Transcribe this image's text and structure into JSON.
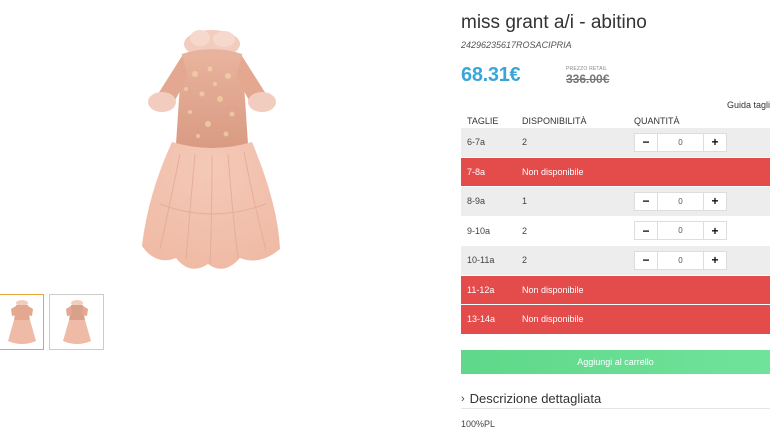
{
  "product": {
    "title": "miss grant a/i - abitino",
    "sku": "24296235617ROSACIPRIA",
    "price": "68.31€",
    "retail_label": "PREZZO RETAIL",
    "retail_price": "336.00€",
    "size_guide": "Guida tagli"
  },
  "table": {
    "headers": {
      "size": "TAGLIE",
      "availability": "DISPONIBILITÀ",
      "quantity": "QUANTITÀ"
    },
    "rows": [
      {
        "size": "6-7a",
        "availability": "2",
        "available": true,
        "qty": "0"
      },
      {
        "size": "7-8a",
        "availability": "Non disponibile",
        "available": false
      },
      {
        "size": "8-9a",
        "availability": "1",
        "available": true,
        "qty": "0"
      },
      {
        "size": "9-10a",
        "availability": "2",
        "available": true,
        "qty": "0"
      },
      {
        "size": "10-11a",
        "availability": "2",
        "available": true,
        "qty": "0"
      },
      {
        "size": "11-12a",
        "availability": "Non disponibile",
        "available": false
      },
      {
        "size": "13-14a",
        "availability": "Non disponibile",
        "available": false
      }
    ],
    "minus": "−",
    "plus": "+"
  },
  "actions": {
    "add_to_cart": "Aggiungi al carrello"
  },
  "description": {
    "toggle_label": "Descrizione dettagliata",
    "chevron": "›",
    "material": "100%PL"
  },
  "colors": {
    "price": "#3aa6d8",
    "unavailable": "#e44b4b",
    "cart": "#5fd88a",
    "thumb_active": "#e8a33a"
  },
  "icons": {
    "dress": "dress-image"
  }
}
